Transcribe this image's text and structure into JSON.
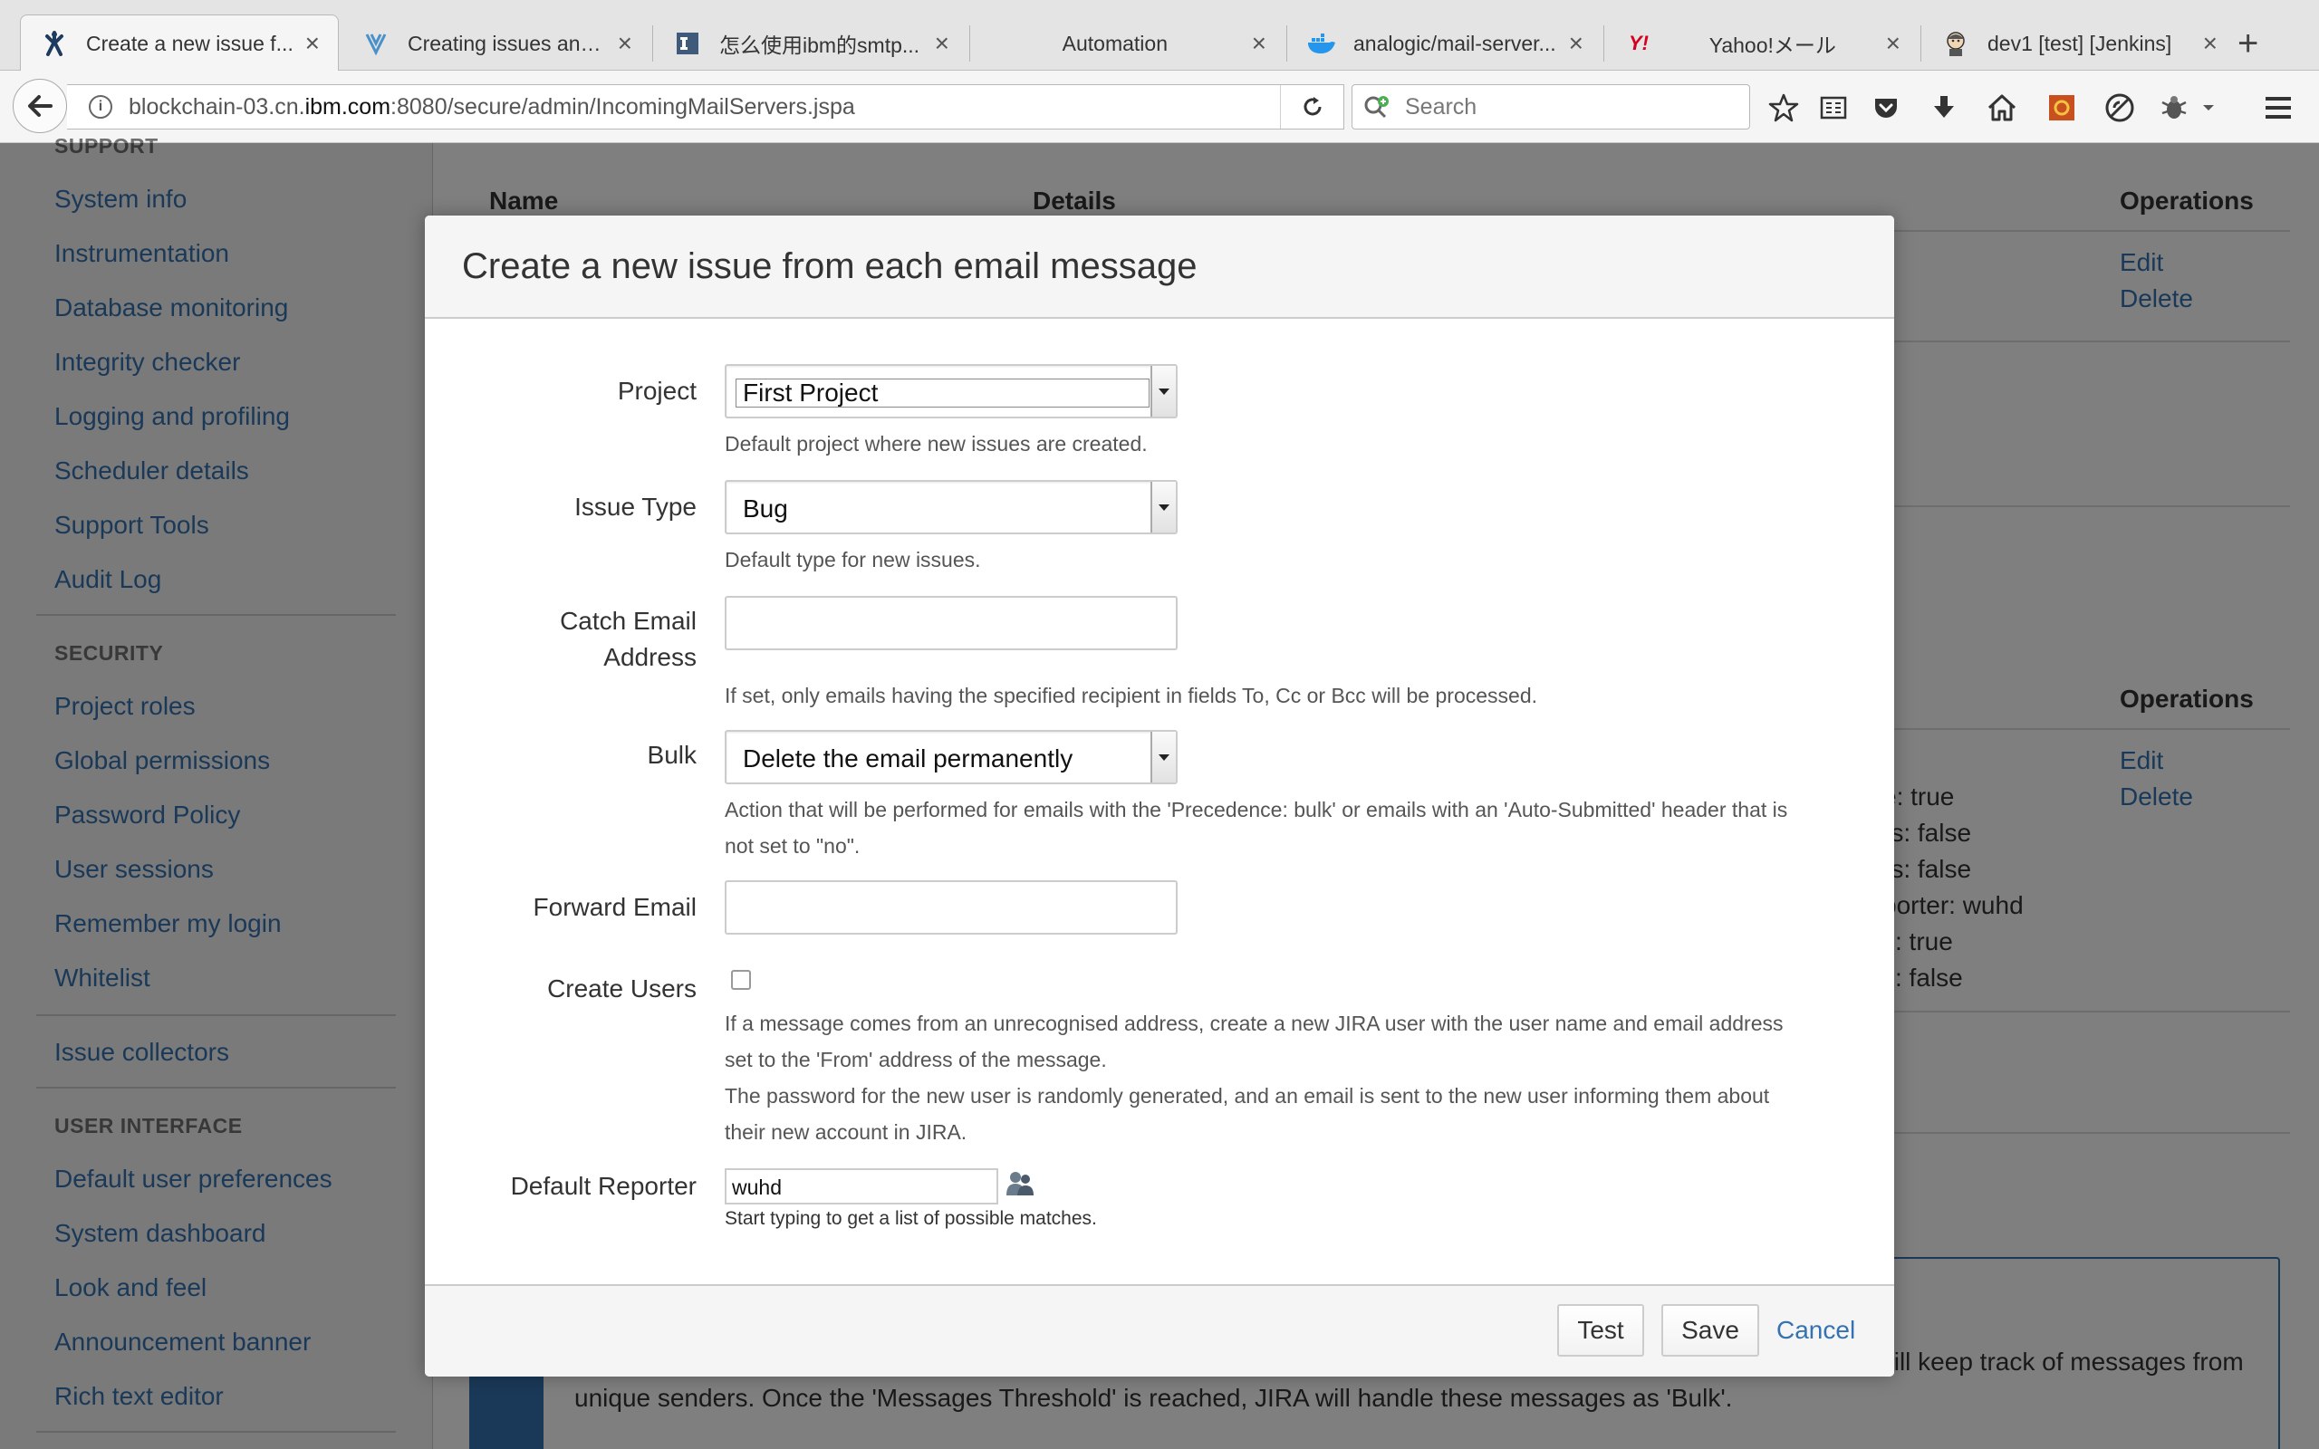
{
  "browser": {
    "tabs": [
      {
        "title": "Create a new issue f...",
        "icon": "jira-icon"
      },
      {
        "title": "Creating issues and ...",
        "icon": "atlassian-icon"
      },
      {
        "title": "怎么使用ibm的smtp...",
        "icon": "document-icon"
      },
      {
        "title": "Automation",
        "icon": ""
      },
      {
        "title": "analogic/mail-server...",
        "icon": "docker-icon"
      },
      {
        "title": "Yahoo!メール",
        "icon": "yahoo-icon"
      },
      {
        "title": "dev1 [test] [Jenkins]",
        "icon": "jenkins-icon"
      }
    ],
    "yahoo_logo": "Y!",
    "url_prefix": "blockchain-03.cn.",
    "url_host": "ibm.com",
    "url_suffix": ":8080/secure/admin/IncomingMailServers.jspa",
    "search_placeholder": "Search",
    "new_tab": "+"
  },
  "sidebar": {
    "support_heading": "SUPPORT",
    "support_items": [
      "System info",
      "Instrumentation",
      "Database monitoring",
      "Integrity checker",
      "Logging and profiling",
      "Scheduler details",
      "Support Tools",
      "Audit Log"
    ],
    "security_heading": "SECURITY",
    "security_items": [
      "Project roles",
      "Global permissions",
      "Password Policy",
      "User sessions",
      "Remember my login",
      "Whitelist"
    ],
    "issue_collectors": "Issue collectors",
    "ui_heading": "USER INTERFACE",
    "ui_items": [
      "Default user preferences",
      "System dashboard",
      "Look and feel",
      "Announcement banner",
      "Rich text editor"
    ]
  },
  "table": {
    "name_header": "Name",
    "details_header": "Details",
    "operations_header": "Operations",
    "edit": "Edit",
    "delete": "Delete",
    "details_fragments": [
      "e: true",
      "rs: false",
      "rs: false",
      "porter: wuhd",
      "s: true",
      "s: false"
    ]
  },
  "info_text": "This section provides configuration option for advanced mail loop detection. When JIRA will be processing emails, it will keep track of messages from unique senders. Once the 'Messages Threshold' is reached, JIRA will handle these messages as 'Bulk'.",
  "dialog": {
    "title": "Create a new issue from each email message",
    "project_label": "Project",
    "project_value": "First Project",
    "project_hint": "Default project where new issues are created.",
    "issue_type_label": "Issue Type",
    "issue_type_value": "Bug",
    "issue_type_hint": "Default type for new issues.",
    "catch_email_label_1": "Catch Email",
    "catch_email_label_2": "Address",
    "catch_email_value": "",
    "catch_email_hint": "If set, only emails having the specified recipient in fields To, Cc or Bcc will be processed.",
    "bulk_label": "Bulk",
    "bulk_value": "Delete the email permanently",
    "bulk_hint_1": "Action that will be performed for emails with the 'Precedence: bulk' or emails with an 'Auto-Submitted' header that is",
    "bulk_hint_2": "not set to \"no\".",
    "forward_email_label": "Forward Email",
    "forward_email_value": "",
    "create_users_label": "Create Users",
    "create_users_checked": false,
    "create_users_hint_1": "If a message comes from an unrecognised address, create a new JIRA user with the user name and email address",
    "create_users_hint_2": "set to the 'From' address of the message.",
    "create_users_hint_3": "The password for the new user is randomly generated, and an email is sent to the new user informing them about",
    "create_users_hint_4": "their new account in JIRA.",
    "default_reporter_label": "Default Reporter",
    "default_reporter_value": "wuhd",
    "default_reporter_hint": "Start typing to get a list of possible matches.",
    "test_button": "Test",
    "save_button": "Save",
    "cancel_link": "Cancel"
  }
}
